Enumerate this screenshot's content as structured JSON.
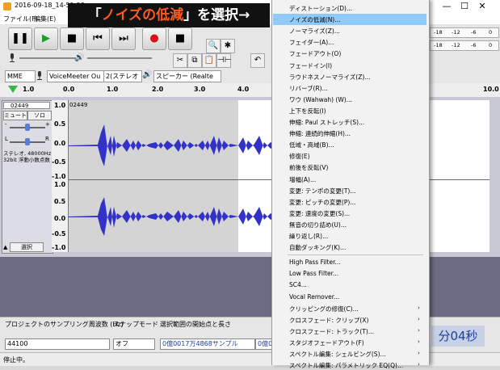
{
  "window": {
    "title": "2016-09-18_14-51-58",
    "min_label": "—",
    "max_label": "☐",
    "close_label": "✕"
  },
  "menubar": [
    "ファイル(F)",
    "編集(E)"
  ],
  "toolbar": {
    "pause": "❚❚",
    "play": "▶",
    "stop": "■",
    "skip_start": "⏮",
    "skip_end": "⏭",
    "record": "●",
    "meter_ticks": [
      "-18",
      "-12",
      "-6",
      "0"
    ]
  },
  "devices": {
    "host": "MME",
    "input": "VoiceMeeter Ou",
    "channels": "2(ステレオ",
    "output": "スピーカー (Realte"
  },
  "ruler": {
    "ticks": [
      "1.0",
      "0.0",
      "1.0",
      "2.0",
      "3.0",
      "4.0",
      "10.0"
    ]
  },
  "track": {
    "name": "02449",
    "clip_name": "02449",
    "mute_label": "ミュート",
    "solo_label": "ソロ",
    "gain_minus": "-",
    "gain_plus": "+",
    "pan_left": "L",
    "pan_right": "R",
    "info_line1": "ステレオ, 48000Hz",
    "info_line2": "32bit 浮動小数点数",
    "select_label": "選択",
    "scale_upper": [
      "1.0",
      "0.5",
      "0.0",
      "-0.5",
      "-1.0"
    ],
    "scale_lower": [
      "1.0",
      "0.5",
      "0.0",
      "-0.5",
      "-1.0"
    ]
  },
  "selection_bar": {
    "rate_label": "プロジェクトのサンプリング周波数 (Hz)",
    "snap_label": "スナップモード",
    "start_label": "選択範囲の開始点と長さ",
    "rate_value": "44100",
    "snap_value": "オフ",
    "start_value": "0億0017万4868サンプル",
    "length_value": "0億0",
    "big_time": "分04秒"
  },
  "status": {
    "text": "停止中。"
  },
  "banner": {
    "open_quote": "「",
    "highlight": "ノイズの低減",
    "close_quote": "」を選択→"
  },
  "effect_menu": {
    "items": [
      "ディストーション(D)...",
      "ノイズの低減(N)...",
      "ノーマライズ(Z)...",
      "フェイダー(A)...",
      "フェードアウト(O)",
      "フェードイン(I)",
      "ラウドネスノーマライズ(Z)...",
      "リバーブ(R)...",
      "ワウ (Wahwah) (W)...",
      "上下を反転(I)",
      "伸縮: Paul ストレッチ(S)...",
      "伸縮: 連続的伸縮(H)...",
      "低域・高域(B)...",
      "修復(E)",
      "前後を反転(V)",
      "増幅(A)...",
      "変更: テンポの変更(T)...",
      "変更: ピッチの変更(P)...",
      "変更: 速度の変更(S)...",
      "無音の切り詰め(U)...",
      "繰り返し(R)...",
      "自動ダッキング(K)...",
      "High Pass Filter...",
      "Low Pass Filter...",
      "SC4...",
      "Vocal Remover...",
      "クリッピングの修復(C)...",
      "クロスフェード: クリップ(X)",
      "クロスフェード: トラック(T)...",
      "スタジオフェードアウト(F)",
      "スペクトル編集: シェルビング(S)...",
      "スペクトル編集: パラメトリック EQ(Q)..."
    ],
    "submenu_arrow": "›"
  }
}
